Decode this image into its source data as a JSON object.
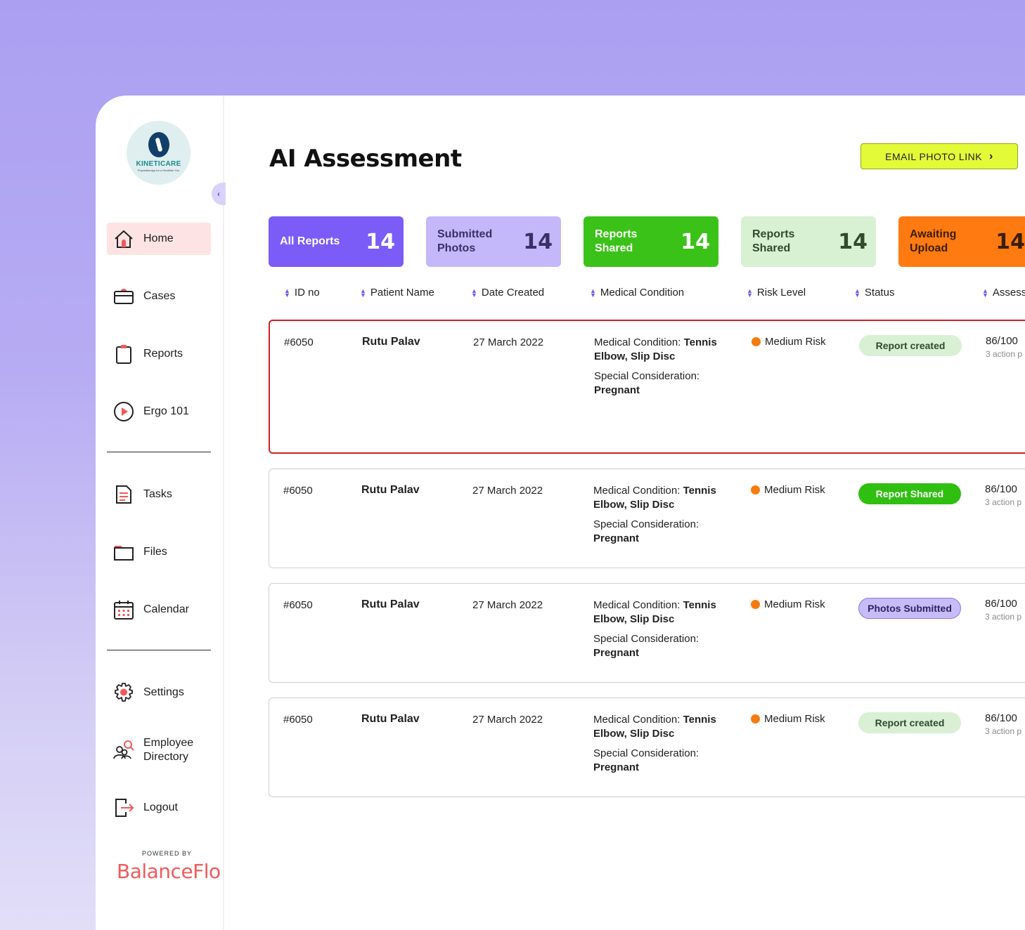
{
  "logo": {
    "brand": "KINETICARE",
    "tagline": "Physiotherapy for a Healthier You"
  },
  "sidebar": {
    "collapse_icon": "chevron-left",
    "items": [
      {
        "label": "Home",
        "icon": "home-icon"
      },
      {
        "label": "Cases",
        "icon": "cases-icon"
      },
      {
        "label": "Reports",
        "icon": "clipboard-icon"
      },
      {
        "label": "Ergo 101",
        "icon": "play-icon"
      },
      {
        "label": "Tasks",
        "icon": "tasks-icon"
      },
      {
        "label": "Files",
        "icon": "folder-icon"
      },
      {
        "label": "Calendar",
        "icon": "calendar-icon"
      },
      {
        "label": "Settings",
        "icon": "gear-icon"
      },
      {
        "label": "Employee Directory",
        "icon": "people-search-icon"
      },
      {
        "label": "Logout",
        "icon": "logout-icon"
      }
    ],
    "powered_by": "POWERED BY",
    "powered_brand": "BalanceFlo"
  },
  "main": {
    "title": "AI Assessment",
    "email_button": "EMAIL PHOTO LINK",
    "stats": [
      {
        "label": "All Reports",
        "value": "14"
      },
      {
        "label": "Submitted Photos",
        "value": "14"
      },
      {
        "label": "Reports Shared",
        "value": "14"
      },
      {
        "label": "Reports Shared",
        "value": "14"
      },
      {
        "label": "Awaiting Upload",
        "value": "14"
      }
    ],
    "columns": [
      "ID no",
      "Patient Name",
      "Date Created",
      "Medical Condition",
      "Risk Level",
      "Status",
      "Assess"
    ],
    "rows": [
      {
        "id": "#6050",
        "name": "Rutu Palav",
        "date": "27 March 2022",
        "cond_label": "Medical Condition:",
        "cond_value": "Tennis Elbow, Slip Disc",
        "spec_label": "Special Consideration:",
        "spec_value": "Pregnant",
        "risk": "Medium Risk",
        "status": "Report created",
        "score": "86/100",
        "actions": "3 action p"
      },
      {
        "id": "#6050",
        "name": "Rutu Palav",
        "date": "27 March 2022",
        "cond_label": "Medical Condition:",
        "cond_value": "Tennis Elbow, Slip Disc",
        "spec_label": "Special Consideration:",
        "spec_value": "Pregnant",
        "risk": "Medium Risk",
        "status": "Report Shared",
        "score": "86/100",
        "actions": "3 action p"
      },
      {
        "id": "#6050",
        "name": "Rutu Palav",
        "date": "27 March 2022",
        "cond_label": "Medical Condition:",
        "cond_value": "Tennis Elbow, Slip Disc",
        "spec_label": "Special Consideration:",
        "spec_value": "Pregnant",
        "risk": "Medium Risk",
        "status": "Photos Submitted",
        "score": "86/100",
        "actions": "3 action p"
      },
      {
        "id": "#6050",
        "name": "Rutu Palav",
        "date": "27 March 2022",
        "cond_label": "Medical Condition:",
        "cond_value": "Tennis Elbow, Slip Disc",
        "spec_label": "Special Consideration:",
        "spec_value": "Pregnant",
        "risk": "Medium Risk",
        "status": "Report created",
        "score": "86/100",
        "actions": "3 action p"
      }
    ]
  },
  "colors": {
    "accent": "#7b5cf6",
    "lime": "#e2fa38",
    "green": "#3ac218",
    "orange": "#ff7a10",
    "risk_medium": "#f57c0f",
    "selected_border": "#d31e25"
  }
}
